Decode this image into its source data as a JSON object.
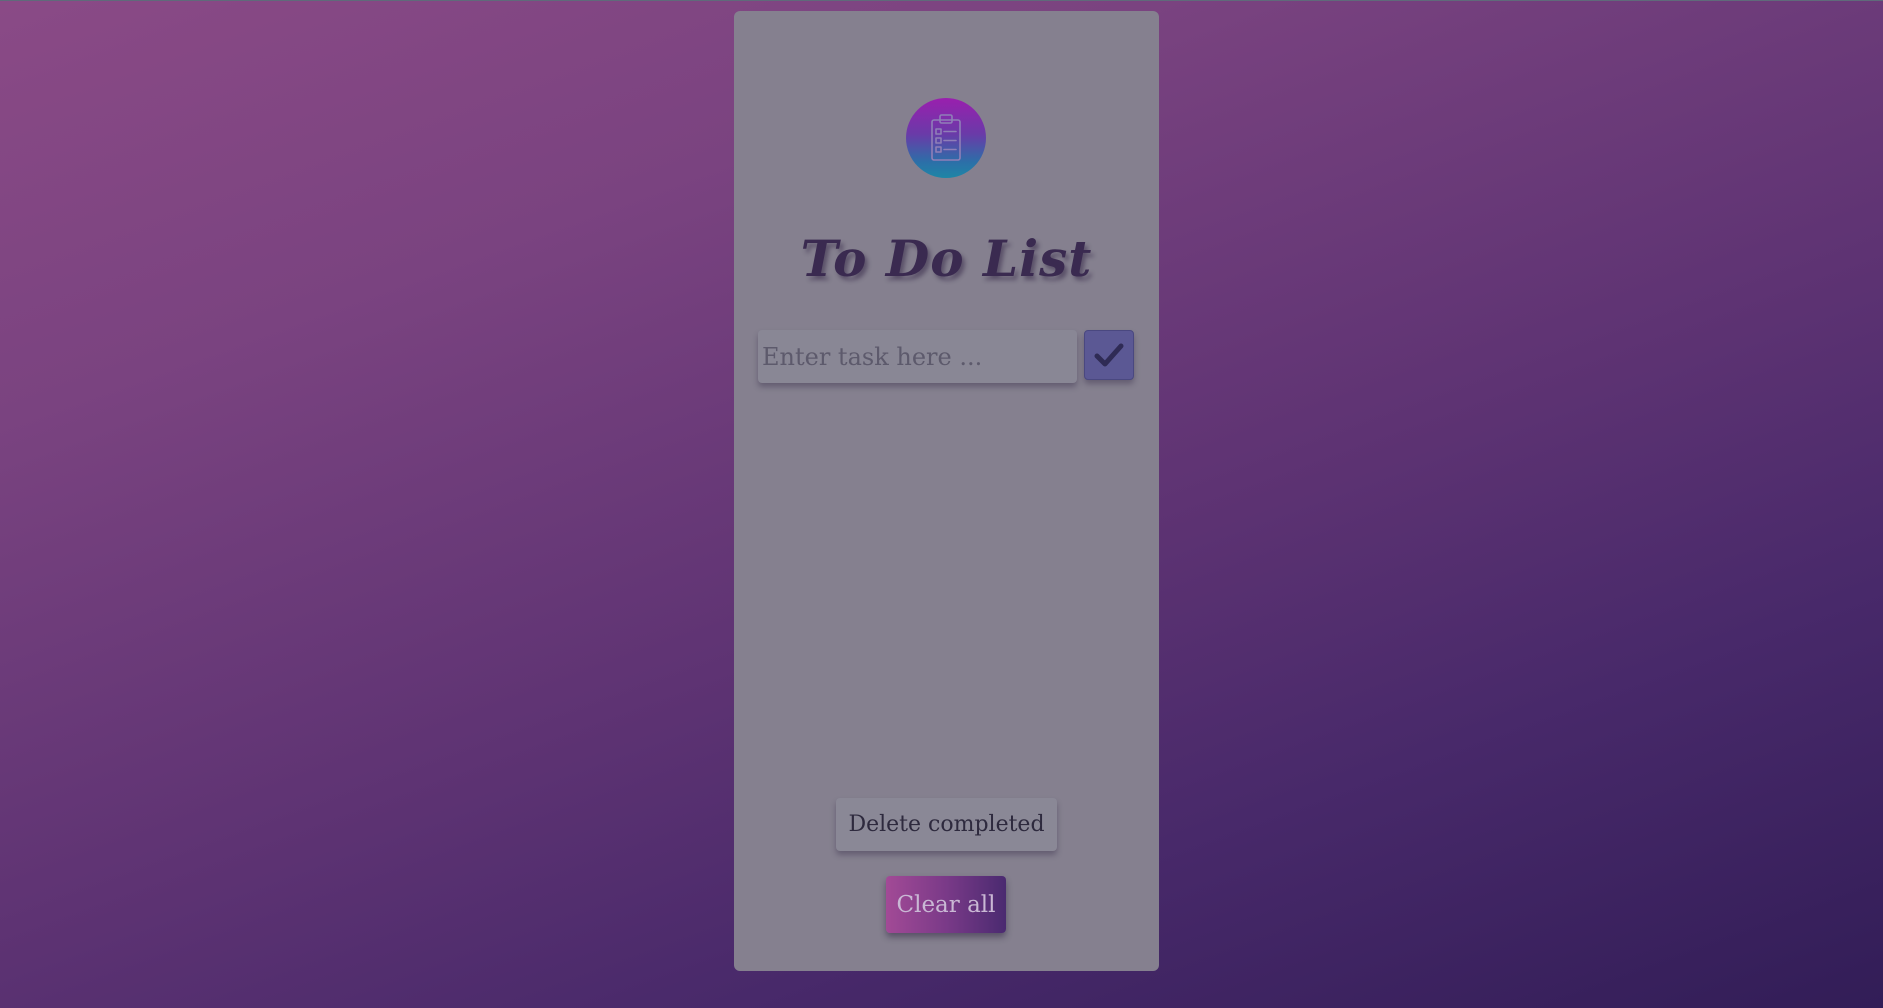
{
  "app": {
    "title": "To Do List"
  },
  "input": {
    "placeholder": "Enter task here ...",
    "value": ""
  },
  "buttons": {
    "add_icon": "checkmark-icon",
    "delete_completed_label": "Delete completed",
    "clear_all_label": "Clear all"
  },
  "logo": {
    "icon": "clipboard-list-icon"
  },
  "tasks": [],
  "colors": {
    "background_start": "#8a4a86",
    "background_end": "#321d57",
    "panel": "#85808f",
    "add_button": "#5b5894",
    "clear_all_gradient_start": "#a24a96",
    "clear_all_gradient_end": "#4a2a70"
  }
}
